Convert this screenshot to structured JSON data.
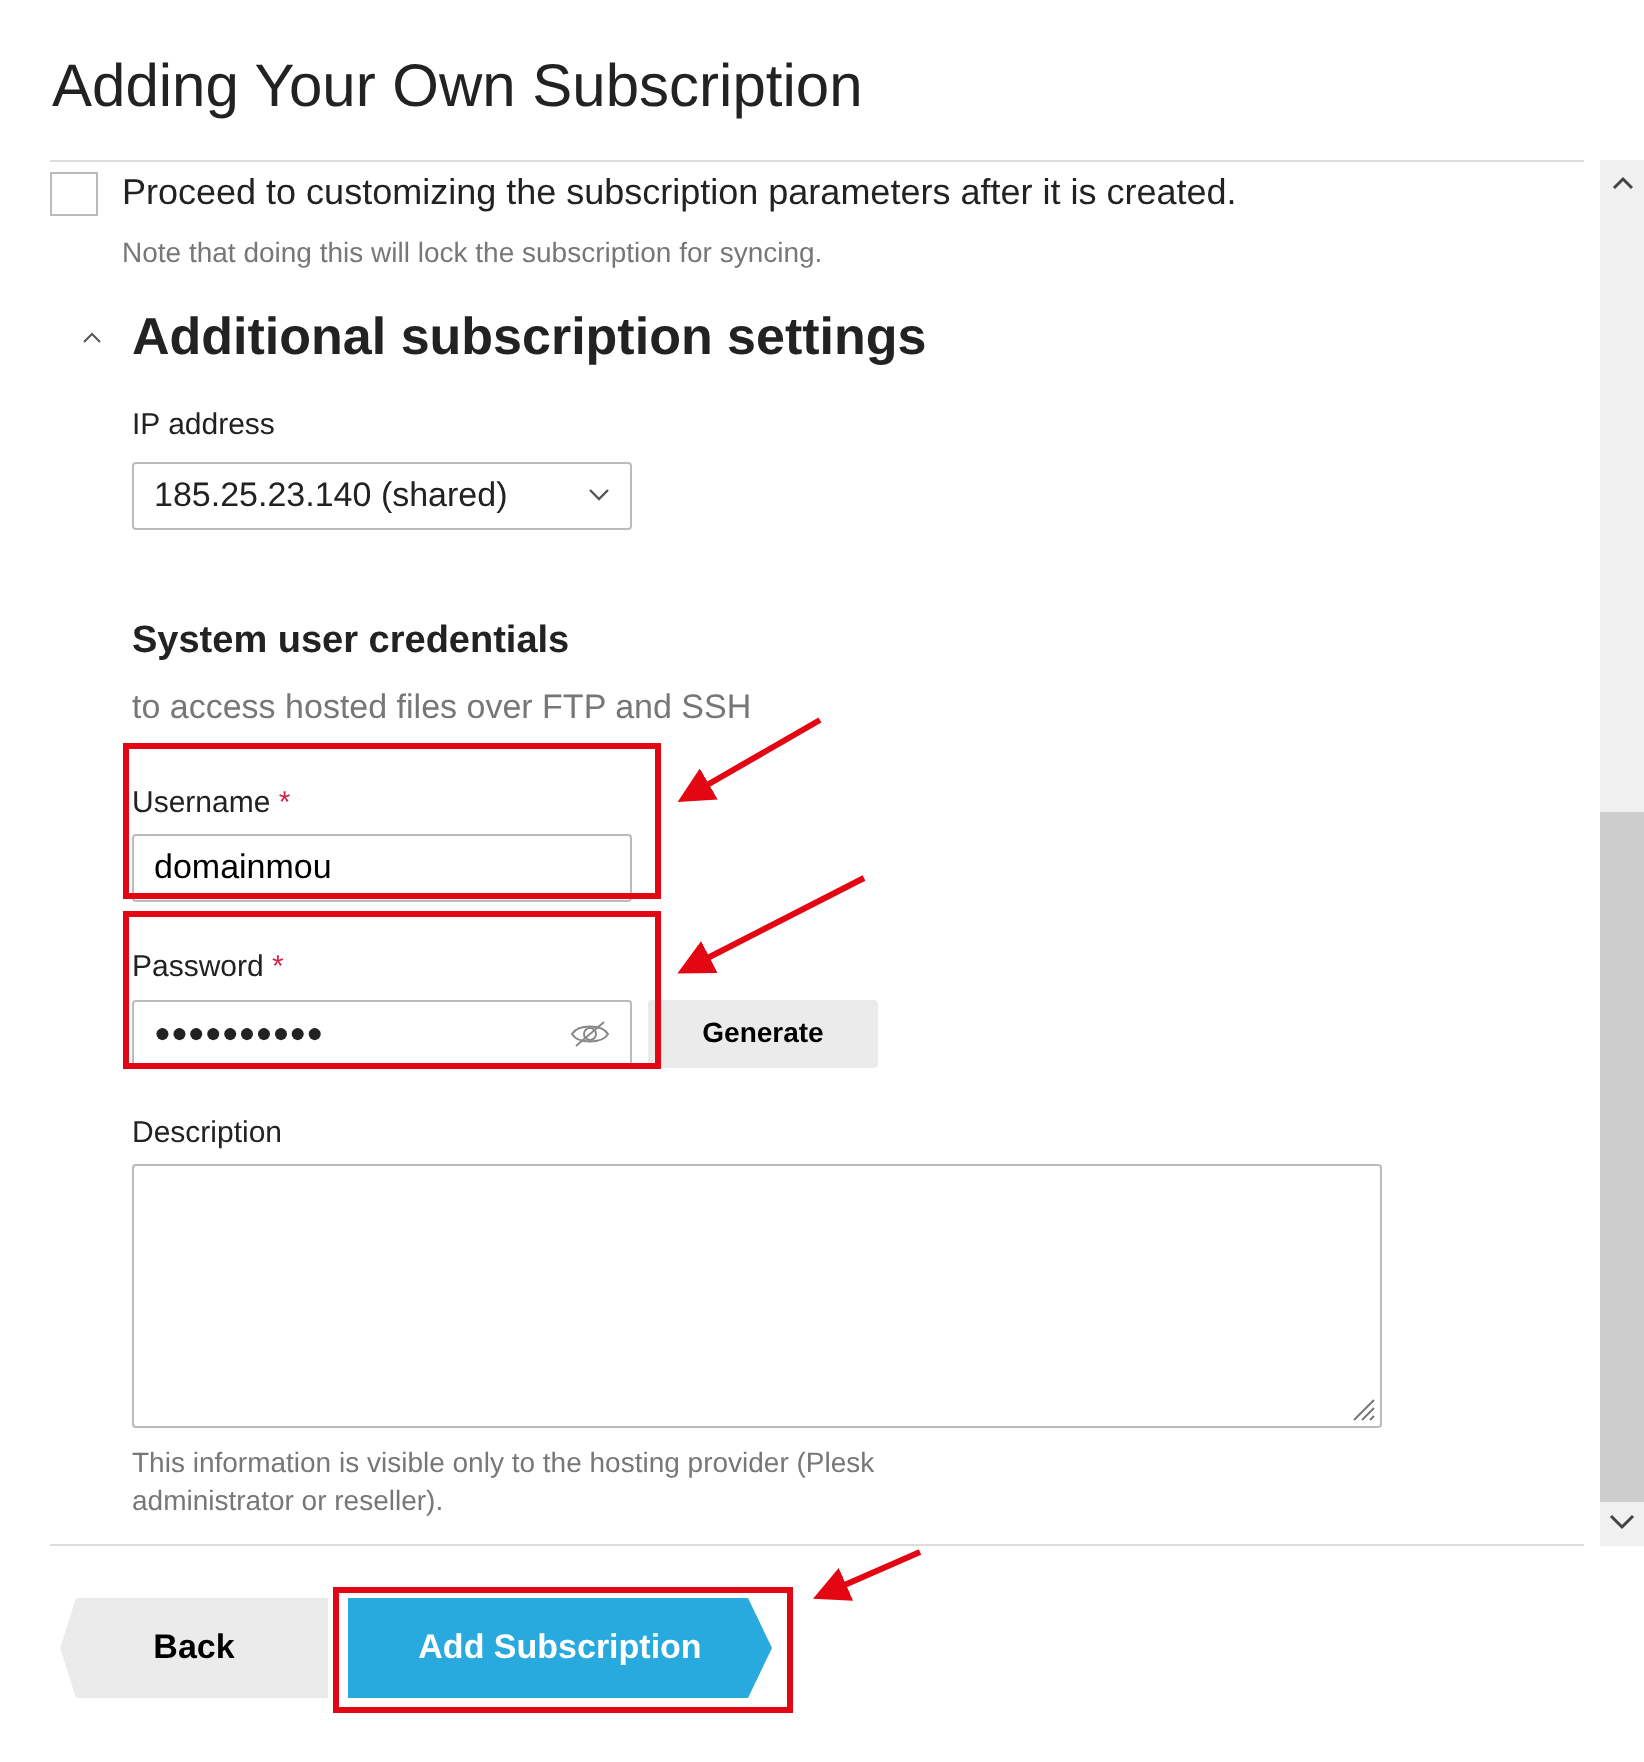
{
  "title": "Adding Your Own Subscription",
  "customize": {
    "label": "Proceed to customizing the subscription parameters after it is created.",
    "note": "Note that doing this will lock the subscription for syncing.",
    "checked": false
  },
  "section": {
    "title": "Additional subscription settings",
    "expanded": true
  },
  "ip_address": {
    "label": "IP address",
    "value": "185.25.23.140 (shared)"
  },
  "credentials": {
    "title": "System user credentials",
    "subtitle": "to access hosted files over FTP and SSH"
  },
  "username": {
    "label": "Username",
    "required_mark": "*",
    "value": "domainmou"
  },
  "password": {
    "label": "Password",
    "required_mark": "*",
    "value": "●●●●●●●●●●",
    "generate": "Generate"
  },
  "description": {
    "label": "Description",
    "note": "This information is visible only to the hosting provider (Plesk administrator or reseller)."
  },
  "buttons": [
    {
      "kind": "back",
      "label": "Back"
    },
    {
      "kind": "primary",
      "label": "Add Subscription"
    }
  ]
}
